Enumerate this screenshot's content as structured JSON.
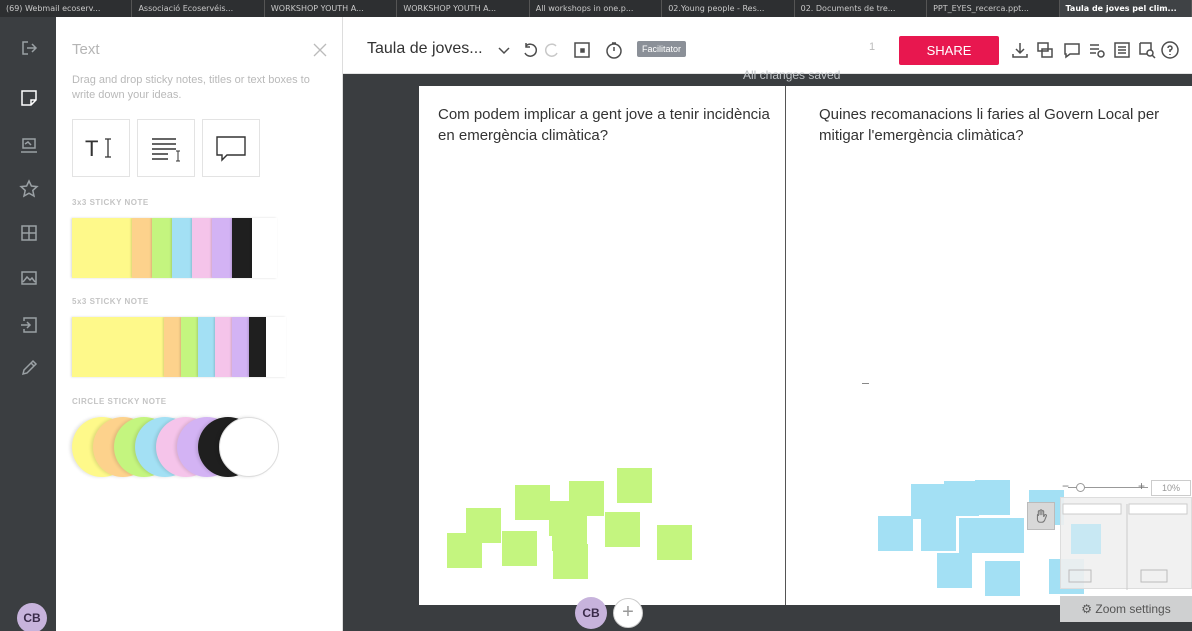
{
  "browser_tabs": [
    "(69) Webmail ecoserv...",
    "Associació Ecoservéis...",
    "WORKSHOP YOUTH A...",
    "WORKSHOP YOUTH A...",
    "All workshops in one.p...",
    "02.Young people - Res...",
    "02. Documents de tre...",
    "PPT_EYES_recerca.ppt...",
    "Taula de joves pel clim..."
  ],
  "sidebar": {
    "avatar_initials": "CB"
  },
  "panel": {
    "title": "Text",
    "description": "Drag and drop sticky notes, titles or text boxes to write down your ideas.",
    "section_3x3": "3x3 STICKY NOTE",
    "section_5x3": "5x3 STICKY NOTE",
    "section_circle": "CIRCLE STICKY NOTE",
    "colors": [
      "#fef98a",
      "#fdd28c",
      "#c4f57f",
      "#a3e0f4",
      "#f5c4ea",
      "#d3b3f4",
      "#1f1f1f",
      "#ffffff"
    ]
  },
  "toolbar": {
    "board_title": "Taula de joves...",
    "facilitator_label": "Facilitator",
    "user_count": "1",
    "share_label": "SHARE",
    "saved_status": "All changes saved"
  },
  "board": {
    "question_left": "Com podem implicar a gent jove a tenir incidència en emergència climàtica?",
    "question_right": "Quines recomanacions li faries al Govern Local per mitigar l'emergència climàtica?"
  },
  "zoom": {
    "level": "10%",
    "settings_label": "Zoom settings"
  },
  "bottom": {
    "avatar_initials": "CB",
    "add_label": "+"
  }
}
